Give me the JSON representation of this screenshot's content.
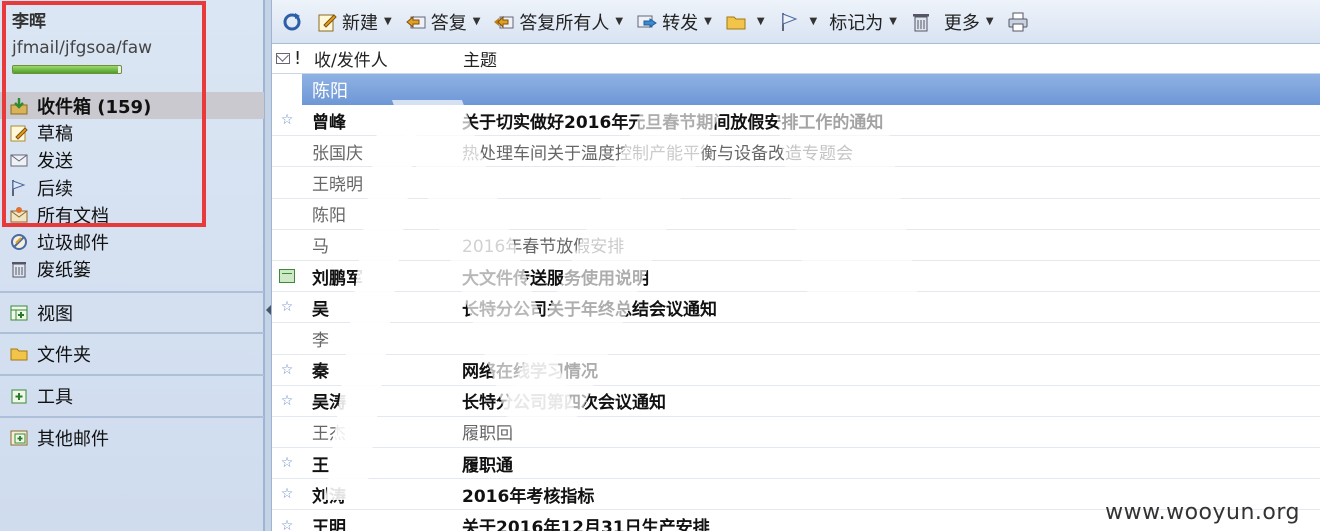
{
  "account": {
    "name": "李晖",
    "path": "jfmail/jfgsoa/faw",
    "quota_fraction": 0.97
  },
  "folders": [
    {
      "label": "收件箱 (159)",
      "icon": "inbox-icon",
      "active": true
    },
    {
      "label": "草稿",
      "icon": "draft-icon"
    },
    {
      "label": "发送",
      "icon": "sent-icon"
    },
    {
      "label": "后续",
      "icon": "flag-icon"
    },
    {
      "label": "所有文档",
      "icon": "all-docs-icon"
    },
    {
      "label": "垃圾邮件",
      "icon": "spam-icon"
    },
    {
      "label": "废纸篓",
      "icon": "trash-icon"
    }
  ],
  "sections": [
    {
      "label": "视图",
      "icon": "views-icon"
    },
    {
      "label": "文件夹",
      "icon": "folder-icon"
    },
    {
      "label": "工具",
      "icon": "tools-icon"
    },
    {
      "label": "其他邮件",
      "icon": "other-mail-icon"
    }
  ],
  "toolbar": {
    "new": "新建",
    "reply": "答复",
    "reply_all": "答复所有人",
    "forward": "转发",
    "mark_as": "标记为",
    "more": "更多"
  },
  "columns": {
    "flag": "!",
    "sender": "收/发件人",
    "subject": "主题"
  },
  "group_label": "陈阳",
  "rows": [
    {
      "icon": "star",
      "sender": "曾峰",
      "subject": "关于切实做好2016年元旦春节期间放假安排工作的通知",
      "unread": true
    },
    {
      "icon": "",
      "sender": "张国庆",
      "subject": "热处理车间关于温度控制产能平衡与设备改造专题会",
      "unread": false
    },
    {
      "icon": "",
      "sender": "王晓明",
      "subject": "",
      "unread": false
    },
    {
      "icon": "",
      "sender": "陈阳",
      "subject": "",
      "unread": false
    },
    {
      "icon": "",
      "sender": "马",
      "subject": "2016年春节放假安排",
      "unread": false
    },
    {
      "icon": "calendar",
      "sender": "刘鹏军",
      "subject": "大文件传送服务使用说明",
      "unread": true
    },
    {
      "icon": "star",
      "sender": "吴",
      "subject": "长特分公司关于年终总结会议通知",
      "unread": true
    },
    {
      "icon": "",
      "sender": "李",
      "subject": "",
      "unread": false
    },
    {
      "icon": "star",
      "sender": "秦",
      "subject": "网络在线学习情况",
      "unread": true
    },
    {
      "icon": "star",
      "sender": "吴涛",
      "subject": "长特分公司第四次会议通知",
      "unread": true
    },
    {
      "icon": "",
      "sender": "王杰",
      "subject": "履职回",
      "unread": false
    },
    {
      "icon": "star",
      "sender": "王",
      "subject": "履职通",
      "unread": true
    },
    {
      "icon": "star",
      "sender": "刘涛",
      "subject": "2016年考核指标",
      "unread": true
    },
    {
      "icon": "star",
      "sender": "王明",
      "subject": "关于2016年12月31日生产安排",
      "unread": true
    }
  ],
  "watermark": "www.wooyun.org",
  "colors": {
    "highlight_box": "#e83a3a",
    "group_header": "#7aa0da",
    "quota_green": "#4c9f2a"
  }
}
